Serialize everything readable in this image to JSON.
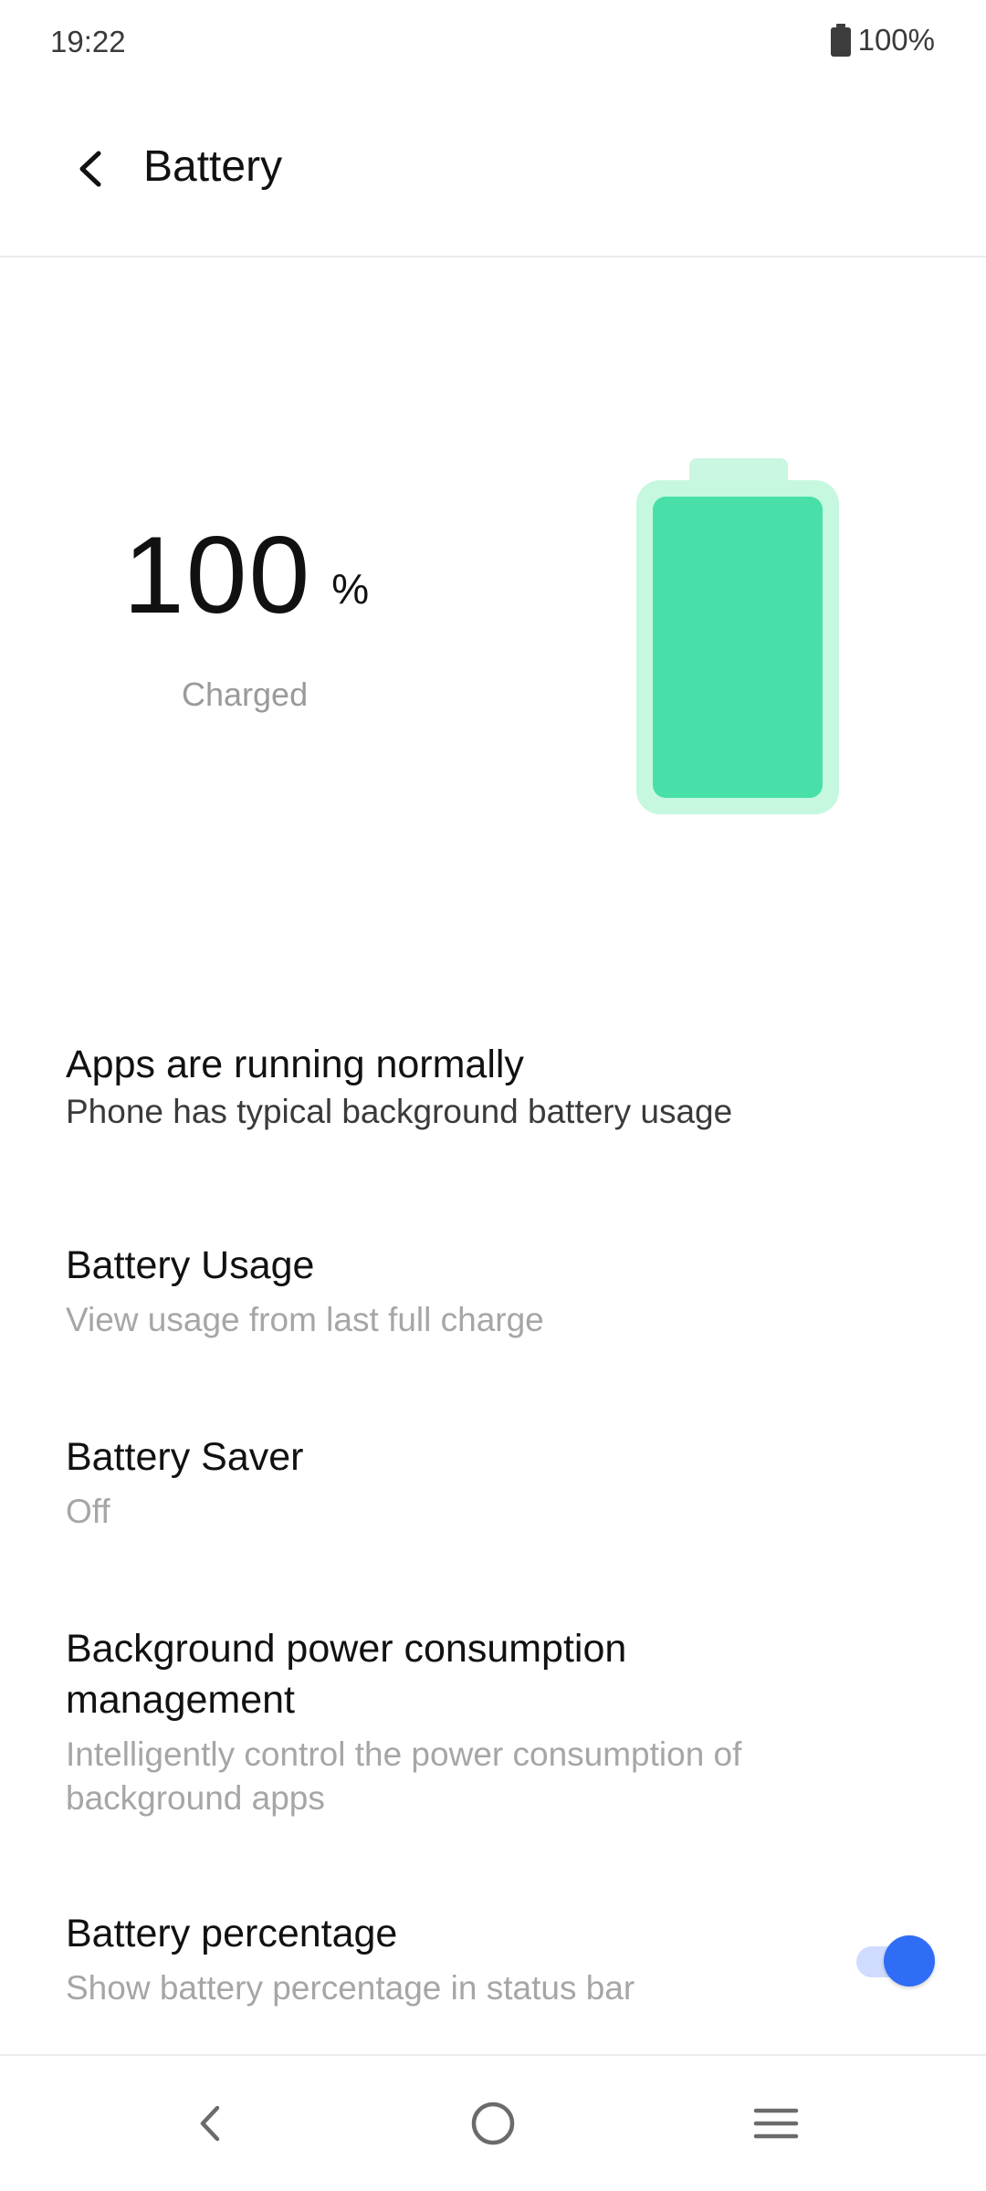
{
  "status_bar": {
    "time": "19:22",
    "battery_percent": "100%"
  },
  "header": {
    "title": "Battery",
    "back_icon": "back-arrow-icon"
  },
  "battery": {
    "level": "100",
    "unit": "%",
    "state": "Charged",
    "fill_level": 1.0,
    "colors": {
      "fill": "#48e0a8",
      "shell": "#c6f8e0"
    }
  },
  "items": [
    {
      "title": "Apps are running normally",
      "subtitle": "Phone has typical background battery usage"
    },
    {
      "title": "Battery Usage",
      "subtitle": "View usage from last full charge"
    },
    {
      "title": "Battery Saver",
      "subtitle": "Off"
    },
    {
      "title": "Background power consumption management",
      "subtitle": "Intelligently control the power consumption of background apps"
    },
    {
      "title": "Battery percentage",
      "subtitle": "Show battery percentage in status bar",
      "toggle_on": true
    }
  ],
  "colors": {
    "accent": "#2f6df6"
  },
  "nav": {
    "back_icon": "nav-back-icon",
    "home_icon": "nav-home-icon",
    "menu_icon": "nav-recents-icon"
  }
}
